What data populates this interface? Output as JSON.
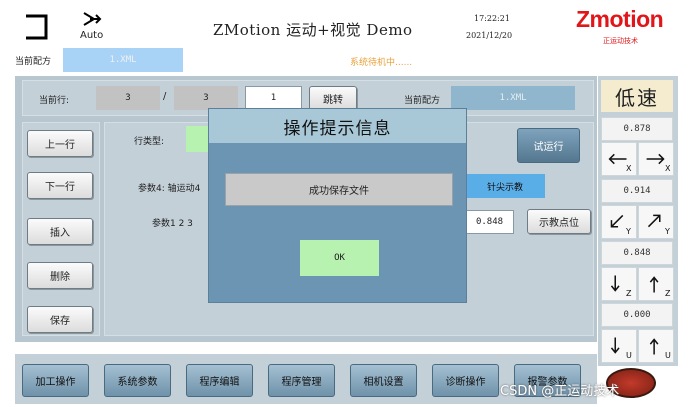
{
  "header": {
    "mode_label": "Auto",
    "title": "ZMotion 运动+视觉 Demo",
    "time": "17:22:21",
    "date": "2021/12/20",
    "brand": "Zmotion",
    "brand_sub": "正运动技术"
  },
  "status": {
    "recipe_label": "当前配方",
    "recipe_value": "1.XML",
    "message": "系统待机中......"
  },
  "program_bar": {
    "current_line_label": "当前行:",
    "current_line": "3",
    "separator": "/",
    "total_lines": "3",
    "jump_input": "1",
    "jump_button": "跳转",
    "recipe_label": "当前配方",
    "recipe_value": "1.XML"
  },
  "left_buttons": {
    "prev": "上一行",
    "next": "下一行",
    "insert": "插入",
    "delete": "删除",
    "save": "保存"
  },
  "editor": {
    "line_type_label": "行类型:",
    "params4_label": "参数4: 轴运动4",
    "params_label": "参数1  2  3",
    "test_run": "试运行",
    "teach_mode": "针尖示教",
    "teach_value": "0.848",
    "teach_point": "示教点位"
  },
  "speed_panel": {
    "speed_label": "低速",
    "x_value": "0.878",
    "y_value": "0.914",
    "z_value": "0.848",
    "u_value": "0.000",
    "axes": [
      "X",
      "X",
      "Y",
      "Y",
      "Z",
      "Z",
      "U",
      "U"
    ]
  },
  "dialog": {
    "title": "操作提示信息",
    "message": "成功保存文件",
    "ok": "OK"
  },
  "bottom_nav": {
    "items": [
      "加工操作",
      "系统参数",
      "程序编辑",
      "程序管理",
      "相机设置",
      "诊断操作",
      "报警参数"
    ]
  },
  "watermark": "CSDN @正运动技术",
  "colors": {
    "panel_bg": "#b8c6cf",
    "recipe_field": "#a9d3f6",
    "dialog_bg": "#6c95b3",
    "dialog_title_bg": "#a8c8d8",
    "ok_green": "#b7f2b0",
    "teach_blue": "#5aaee8",
    "brand_red": "#e0161a"
  }
}
